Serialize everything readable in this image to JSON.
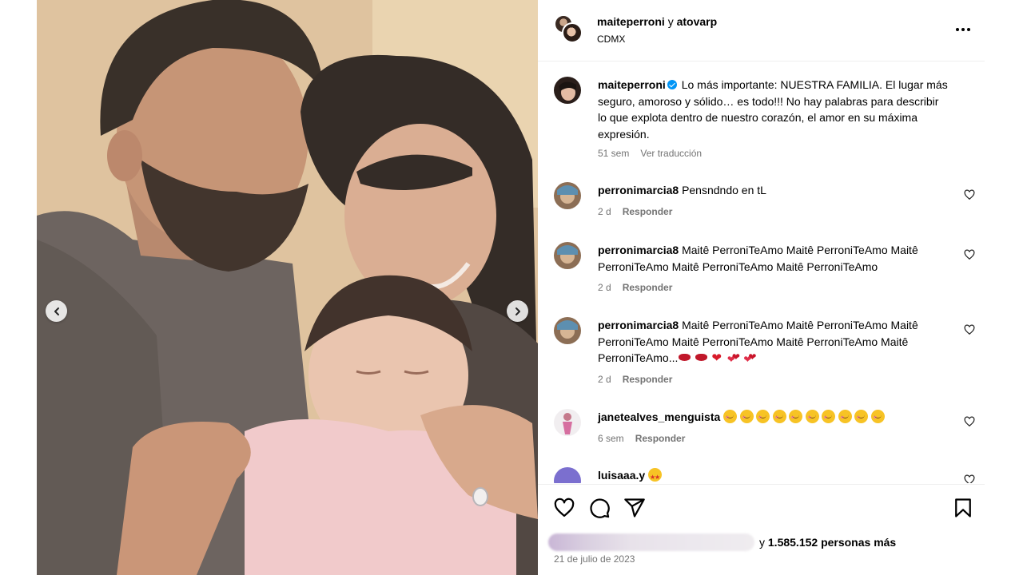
{
  "header": {
    "user1": "maiteperroni",
    "conjunction": "y",
    "user2": "atovarp",
    "location": "CDMX",
    "more_icon": "more-horizontal-icon"
  },
  "caption": {
    "username": "maiteperroni",
    "verified": true,
    "text": "Lo más importante: NUESTRA FAMILIA. El lugar más seguro, amoroso y sólido… es todo!!! No hay palabras para describir lo que explota dentro de nuestro corazón, el amor en su máxima expresión.",
    "time": "51 sem",
    "translate": "Ver traducción"
  },
  "comments": [
    {
      "username": "perronimarcia8",
      "text": "Pensndndo en tL",
      "time": "2 d",
      "reply": "Responder"
    },
    {
      "username": "perronimarcia8",
      "text": "Maitê PerroniTeAmo Maitê PerroniTeAmo Maitê PerroniTeAmo Maitê PerroniTeAmo Maitê PerroniTeAmo",
      "time": "2 d",
      "reply": "Responder"
    },
    {
      "username": "perronimarcia8",
      "text": "Maitê PerroniTeAmo Maitê PerroniTeAmo Maitê PerroniTeAmo Maitê PerroniTeAmo Maitê PerroniTeAmo Maitê PerroniTeAmo...",
      "emojis": [
        "kiss-mark",
        "kiss-mark",
        "red-heart",
        "two-hearts",
        "two-hearts"
      ],
      "time": "2 d",
      "reply": "Responder"
    },
    {
      "username": "janetealves_menguista",
      "text": "",
      "emojis": [
        "smiling-face-with-hearts",
        "smiling-face-with-hearts",
        "smiling-face-with-hearts",
        "smiling-face-with-hearts",
        "smiling-face-with-hearts",
        "smiling-face-with-hearts",
        "smiling-face-with-hearts",
        "smiling-face-with-hearts",
        "smiling-face-with-hearts",
        "smiling-face-with-hearts"
      ],
      "time": "6 sem",
      "reply": "Responder"
    },
    {
      "username": "luisaaa.y",
      "text": "",
      "emojis": [
        "star-struck"
      ]
    }
  ],
  "actions": {
    "like_icon": "heart-outline-icon",
    "comment_icon": "comment-icon",
    "share_icon": "send-icon",
    "save_icon": "bookmark-icon"
  },
  "likes": {
    "prefix": "y",
    "count_text": "1.585.152 personas más"
  },
  "date": "21 de julio de 2023",
  "colors": {
    "accent": "#0095f6",
    "muted": "#737373",
    "divider": "#efefef"
  }
}
